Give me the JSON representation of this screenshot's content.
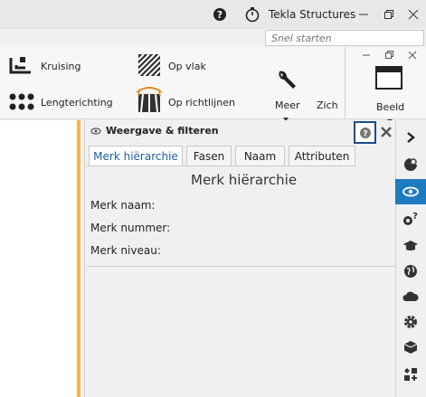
{
  "titlebar": {
    "app_title": "Tekla Structures",
    "help_icon": "help-circle-icon",
    "timer_icon": "stopwatch-icon",
    "minimize_icon": "minimize-icon",
    "restore_icon": "restore-icon",
    "close_icon": "close-icon"
  },
  "search": {
    "placeholder": "Snel starten"
  },
  "ribbon": {
    "kruising": "Kruising",
    "lengterichting": "Lengterichting",
    "op_vlak": "Op vlak",
    "op_richtlijnen": "Op richtlijnen",
    "meer": "Meer",
    "zich": "Zich",
    "beeld": "Beeld"
  },
  "panel": {
    "title": "Weergave & filteren",
    "tabs": [
      {
        "label": "Merk hiërarchie"
      },
      {
        "label": "Fasen"
      },
      {
        "label": "Naam"
      },
      {
        "label": "Attributen"
      }
    ],
    "section_title": "Merk hiërarchie",
    "fields": [
      {
        "label": "Merk naam:"
      },
      {
        "label": "Merk nummer:"
      },
      {
        "label": "Merk niveau:"
      }
    ]
  },
  "colors": {
    "accent": "#1f7bbf",
    "canvas_border": "#f5b642",
    "help_box_border": "#1a4d8c"
  },
  "vbar_icons": [
    "chevron-right-icon",
    "pie-refresh-icon",
    "eye-link-icon",
    "gear-question-icon",
    "graduation-cap-icon",
    "globe-icon",
    "cloud-icon",
    "gear-icon",
    "cube-icon",
    "apps-add-icon"
  ]
}
